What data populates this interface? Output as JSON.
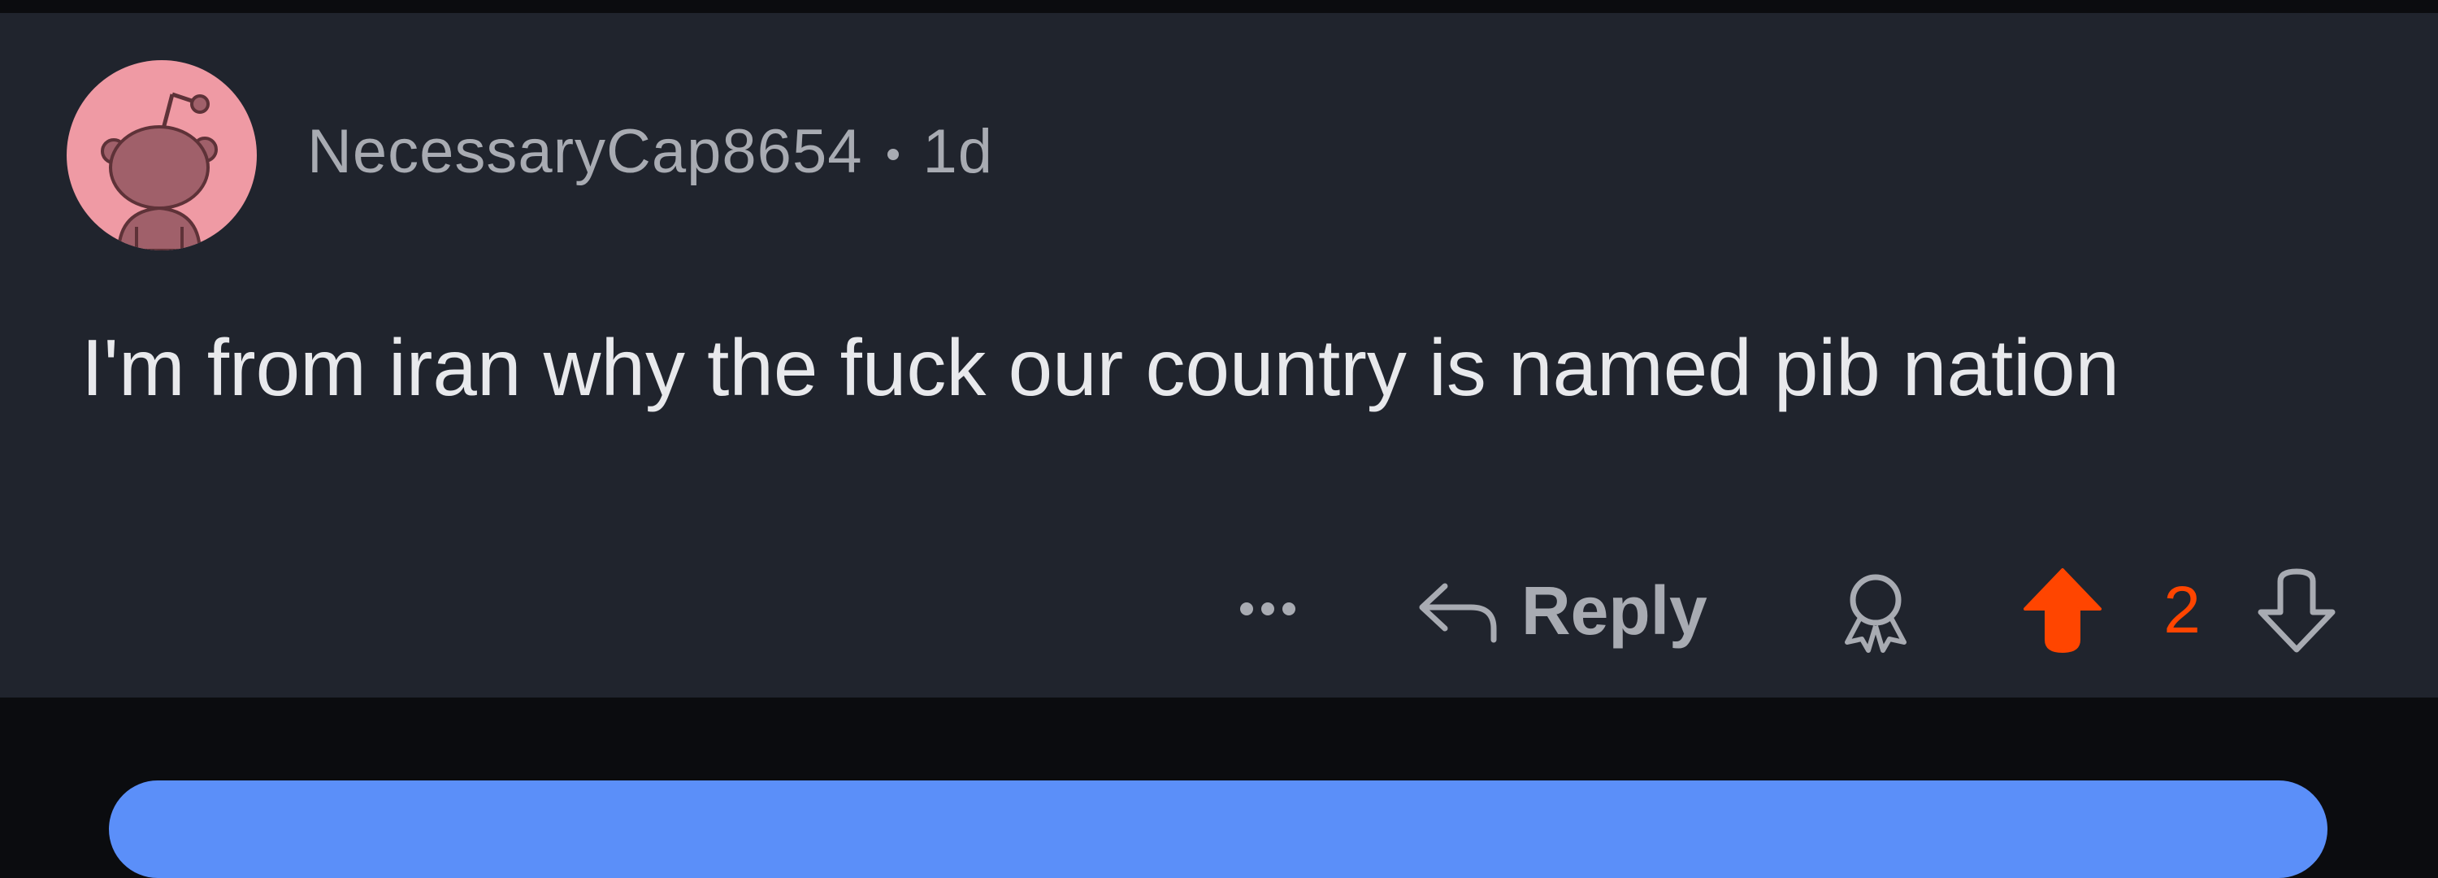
{
  "comment": {
    "username": "NecessaryCap8654",
    "age": "1d",
    "text": "I'm from iran why the fuck our country is named pib nation",
    "avatar_icon": "reddit-snoo-avatar-icon",
    "avatar_color": "#ef9aa4"
  },
  "actions": {
    "more_icon": "more-options-icon",
    "reply_icon": "reply-arrow-icon",
    "reply_label": "Reply",
    "award_icon": "award-icon",
    "upvote_icon": "upvote-arrow-icon",
    "score": "2",
    "downvote_icon": "downvote-arrow-icon"
  },
  "colors": {
    "card_bg": "#20242d",
    "page_bg": "#0b0c0f",
    "muted_text": "#a8abb2",
    "body_text": "#e8e9ec",
    "upvote_active": "#ff4500",
    "next_card_accent": "#5b8ff9"
  }
}
